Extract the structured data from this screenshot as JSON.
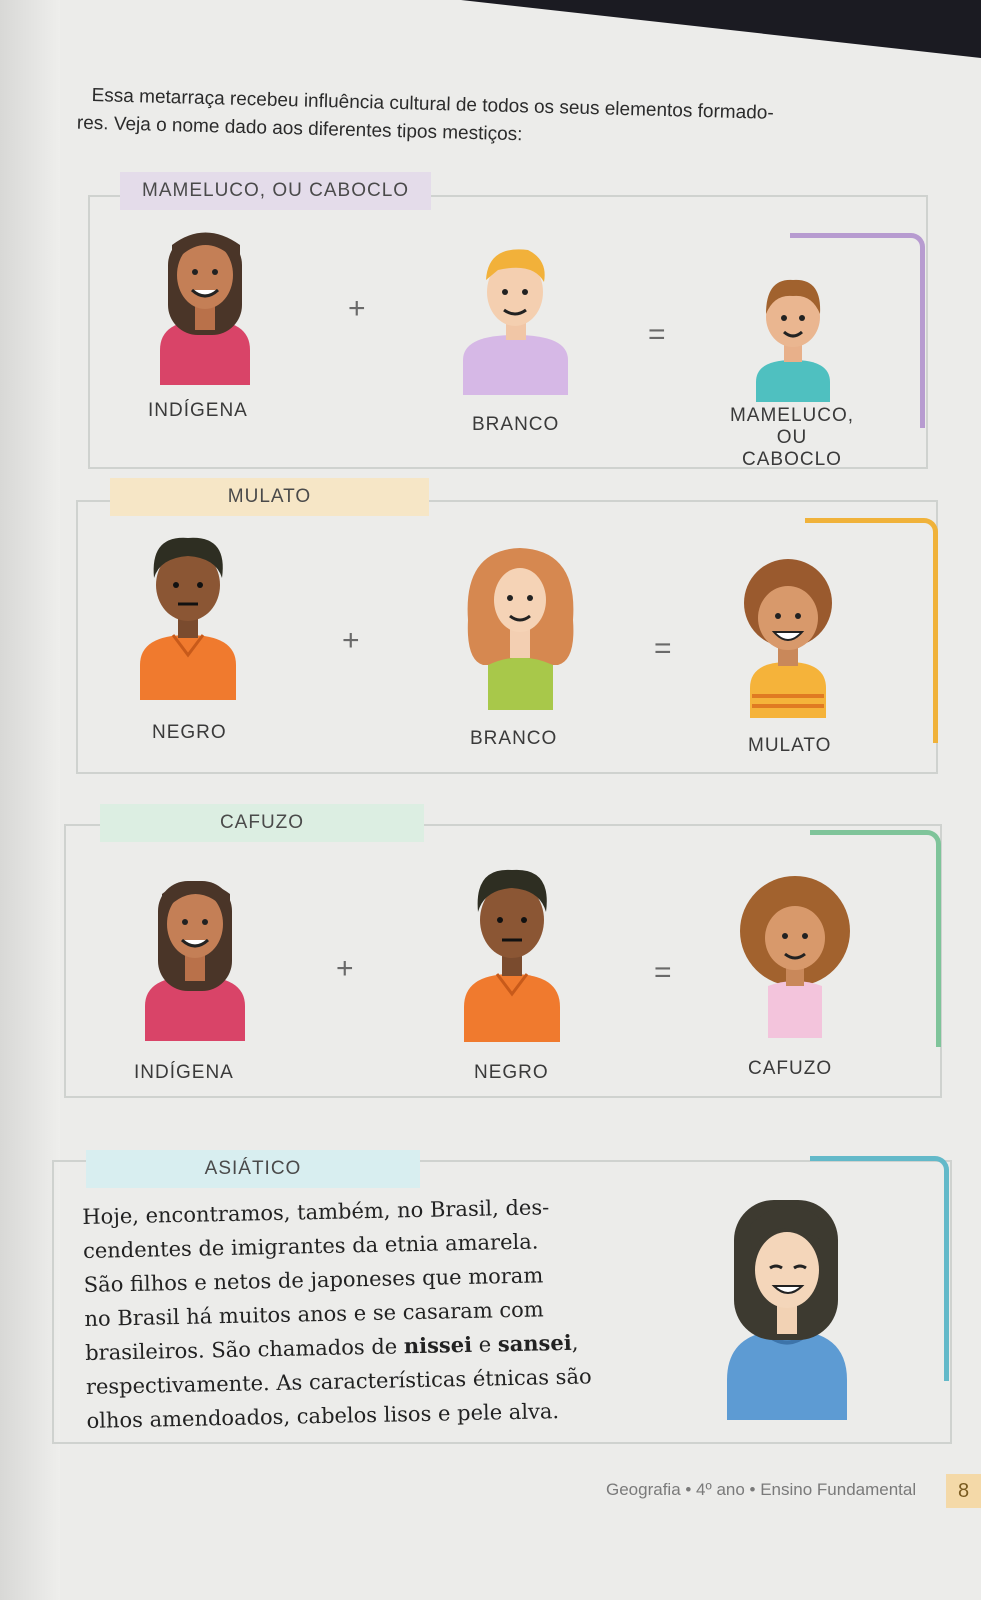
{
  "intro": {
    "line1": "Essa metarraça recebeu influência cultural de todos os seus elementos formado-",
    "line2": "res. Veja o nome dado aos diferentes tipos mestiços:"
  },
  "sections": [
    {
      "title": "MAMELUCO, OU CABOCLO",
      "left": "INDÍGENA",
      "middle": "BRANCO",
      "result_l1": "MAMELUCO, OU",
      "result_l2": "CABOCLO",
      "plus": "+",
      "equals": "="
    },
    {
      "title": "MULATO",
      "left": "NEGRO",
      "middle": "BRANCO",
      "result": "MULATO",
      "plus": "+",
      "equals": "="
    },
    {
      "title": "CAFUZO",
      "left": "INDÍGENA",
      "middle": "NEGRO",
      "result": "CAFUZO",
      "plus": "+",
      "equals": "="
    }
  ],
  "asian": {
    "title": "ASIÁTICO",
    "lines": [
      "Hoje, encontramos, também, no Brasil, des-",
      "cendentes de imigrantes da etnia amarela.",
      "São filhos e netos de japoneses que moram",
      "no Brasil há muitos anos e se casaram com"
    ],
    "line5_pre": "brasileiros. São chamados de ",
    "bold1": "nissei",
    "line5_mid": " e ",
    "bold2": "sansei",
    "line5_post": ",",
    "line6": "respectivamente. As características étnicas são",
    "line7": "olhos amendoados, cabelos lisos e pele alva."
  },
  "footer": "Geografia • 4º ano • Ensino Fundamental",
  "page_number": "8",
  "colors": {
    "purple": "#b79bd0",
    "yellow": "#f0b23a",
    "green": "#7fc49a",
    "teal": "#63b9c9"
  }
}
